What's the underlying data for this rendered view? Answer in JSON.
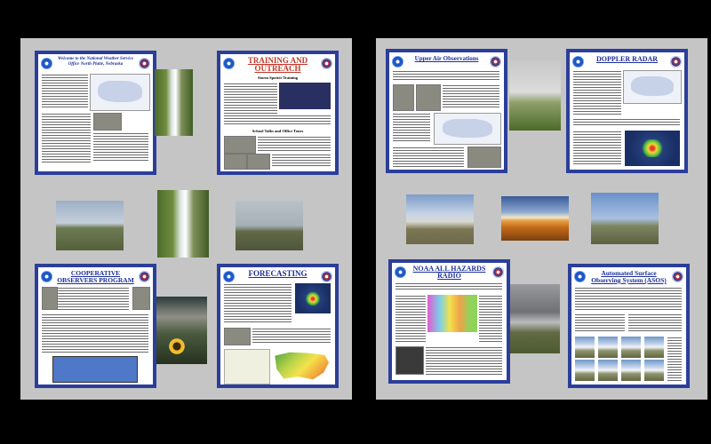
{
  "posters": {
    "p1": {
      "title": "Welcome to the National Weather Service Office North Platte, Nebraska"
    },
    "p2": {
      "title": "TRAINING AND OUTREACH",
      "sub1": "Storm Spotter Training",
      "sub2": "School Talks and Office Tours"
    },
    "p3": {
      "title": "COOPERATIVE OBSERVERS PROGRAM"
    },
    "p4": {
      "title": "FORECASTING"
    },
    "p5": {
      "title": "Upper Air Observations"
    },
    "p6": {
      "title": "DOPPLER RADAR"
    },
    "p7": {
      "title": "NOAA ALL HAZARDS RADIO"
    },
    "p8": {
      "title": "Automated Surface Observing System (ASOS)"
    }
  },
  "colors": {
    "background": "#000000",
    "board": "#c5c5c5",
    "poster_border": "#2b3e9a",
    "title": "#1d2f9a"
  }
}
